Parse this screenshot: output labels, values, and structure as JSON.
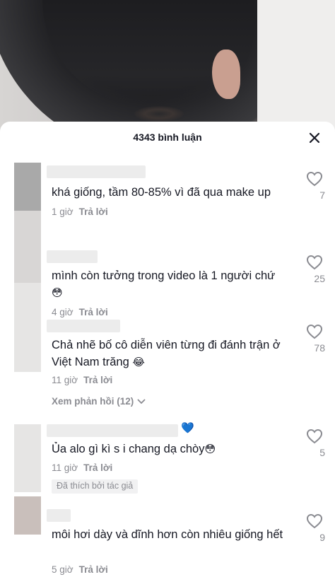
{
  "header": {
    "title": "4343 bình luận"
  },
  "comments": [
    {
      "text": "khá giống, tầm 80-85% vì đã qua make up",
      "time": "1 giờ",
      "reply_label": "Trả lời",
      "likes": "7"
    },
    {
      "text": "mình còn tưởng trong video là 1 người chứ",
      "emoji": "😳",
      "time": "4 giờ",
      "reply_label": "Trả lời",
      "likes": "25"
    },
    {
      "text": "Chả nhẽ bố cô diễn viên từng đi đánh trận ở Việt Nam trăng",
      "emoji": "😂",
      "time": "11 giờ",
      "reply_label": "Trả lời",
      "likes": "78",
      "view_replies": "Xem phản hồi (12)"
    },
    {
      "text": "Ủa alo gì kì s i chang dạ chòy",
      "emoji": "😳",
      "name_emoji": "💙",
      "time": "11 giờ",
      "reply_label": "Trả lời",
      "likes": "5",
      "liked_by_author": "Đã thích bởi tác giả"
    },
    {
      "text": "môi hơi dày và dĩnh hơn còn nhiêu giống hết",
      "time": "5 giờ",
      "reply_label": "Trả lời",
      "likes": "9"
    }
  ],
  "icons": {
    "close": "close-icon",
    "like": "heart-outline-icon",
    "expand": "chevron-down-icon"
  }
}
